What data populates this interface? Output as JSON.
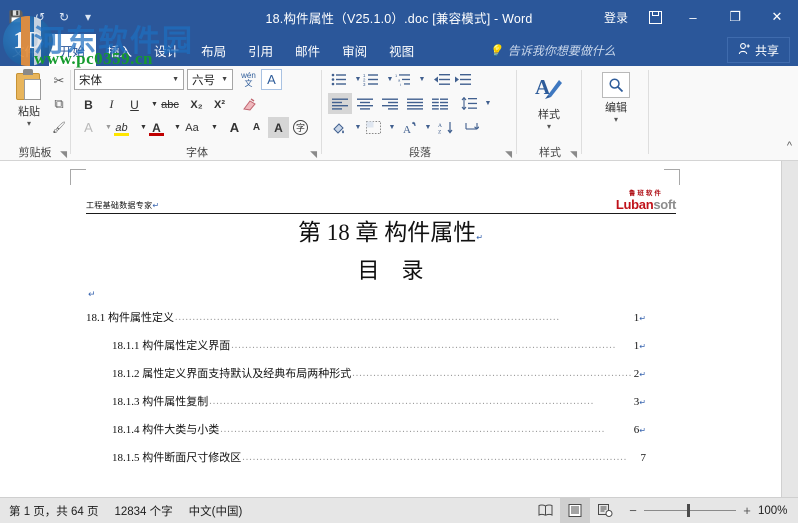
{
  "window": {
    "title": "18.构件属性（V25.1.0）.doc [兼容模式]  -  Word",
    "signin_label": "登录",
    "ribbon_display_icon": "ribbon-display-options-icon",
    "minimize_icon": "–",
    "maximize_icon": "❐",
    "close_icon": "✕"
  },
  "quick_access": {
    "save_icon": "💾",
    "undo_icon": "↺",
    "redo_icon": "↻",
    "customize_icon": "▾"
  },
  "tabs": [
    {
      "label": "文件",
      "name": "tab-file",
      "active": false,
      "file": true
    },
    {
      "label": "开始",
      "name": "tab-home",
      "active": true
    },
    {
      "label": "插入",
      "name": "tab-insert",
      "active": false
    },
    {
      "label": "设计",
      "name": "tab-design",
      "active": false
    },
    {
      "label": "布局",
      "name": "tab-layout",
      "active": false
    },
    {
      "label": "引用",
      "name": "tab-references",
      "active": false
    },
    {
      "label": "邮件",
      "name": "tab-mailings",
      "active": false
    },
    {
      "label": "审阅",
      "name": "tab-review",
      "active": false
    },
    {
      "label": "视图",
      "name": "tab-view",
      "active": false
    }
  ],
  "tellme": {
    "label": "告诉我你想要做什么",
    "icon": "lightbulb-icon"
  },
  "share": {
    "label": "共享",
    "icon": "share-person-icon"
  },
  "ribbon": {
    "collapse_icon": "^",
    "groups": {
      "clipboard": {
        "label": "剪贴板",
        "paste_label": "粘贴",
        "cut_icon": "✂",
        "copy_icon": "⧉",
        "format_painter_icon": "🖌"
      },
      "font": {
        "label": "字体",
        "font_name": "宋体",
        "font_size": "六号",
        "phonetic_guide_icon": "wén",
        "character_border_icon": "A",
        "bold": "B",
        "italic": "I",
        "underline": "U",
        "strikethrough": "abc",
        "subscript": "X₂",
        "superscript": "X²",
        "clear_format_icon": "clear-formatting-icon",
        "text_effects": "A",
        "highlight": "ab",
        "font_color": "A",
        "change_case": "Aa",
        "grow_font": "A",
        "shrink_font": "A",
        "char_shading": "A",
        "enclose_char": "字"
      },
      "paragraph": {
        "label": "段落",
        "bullets_icon": "bullet-list-icon",
        "numbering_icon": "numbered-list-icon",
        "multilevel_icon": "multilevel-list-icon",
        "decrease_indent_icon": "decrease-indent-icon",
        "increase_indent_icon": "increase-indent-icon",
        "align_left_icon": "align-left-icon",
        "align_center_icon": "align-center-icon",
        "align_right_icon": "align-right-icon",
        "justify_icon": "justify-icon",
        "distribute_icon": "distribute-icon",
        "line_spacing_icon": "line-spacing-icon",
        "shading_icon": "shading-icon",
        "borders_icon": "borders-icon",
        "asian_layout_icon": "asian-layout-icon",
        "sort_icon": "sort-az-icon",
        "show_marks_icon": "show-paragraph-marks-icon"
      },
      "styles": {
        "label": "样式",
        "button_label": "样式",
        "icon": "styles-pen-icon"
      },
      "editing": {
        "label": "",
        "button_label": "编辑",
        "icon": "magnifier-icon"
      }
    }
  },
  "document": {
    "header_left": "工程基础数据专家",
    "logo_cn": "鲁班软件",
    "logo_en_dark": "Luban",
    "logo_en_light": "soft",
    "title": "第 18 章 构件属性",
    "subtitle": "目录",
    "toc": [
      {
        "text": "18.1 构件属性定义",
        "page": "1",
        "level": 1
      },
      {
        "text": "18.1.1 构件属性定义界面",
        "page": "1",
        "level": 2
      },
      {
        "text": "18.1.2 属性定义界面支持默认及经典布局两种形式",
        "page": "2",
        "level": 2
      },
      {
        "text": "18.1.3 构件属性复制",
        "page": "3",
        "level": 2
      },
      {
        "text": "18.1.4 构件大类与小类",
        "page": "6",
        "level": 2
      },
      {
        "text": "18.1.5 构件断面尺寸修改区",
        "page": "7",
        "level": 2
      }
    ],
    "pilcrow": "↵"
  },
  "statusbar": {
    "page_info": "第 1 页，共 64 页",
    "word_count": "12834 个字",
    "language": "中文(中国)",
    "view_read_icon": "read-mode-icon",
    "view_print_icon": "print-layout-icon",
    "view_web_icon": "web-layout-icon",
    "zoom_out": "−",
    "zoom_in": "+",
    "zoom_level": "100%"
  },
  "watermark": {
    "logo_text": "1D",
    "site_name": "河东软件园",
    "url": "www.pc0359.cn"
  },
  "colors": {
    "word_blue": "#2b579a",
    "ribbon_bg": "#f9f9f9",
    "status_bg": "#e6e6e6",
    "logo_red": "#c0121a",
    "watermark_blue": "#1e6fc0",
    "watermark_green": "#169b2e"
  }
}
